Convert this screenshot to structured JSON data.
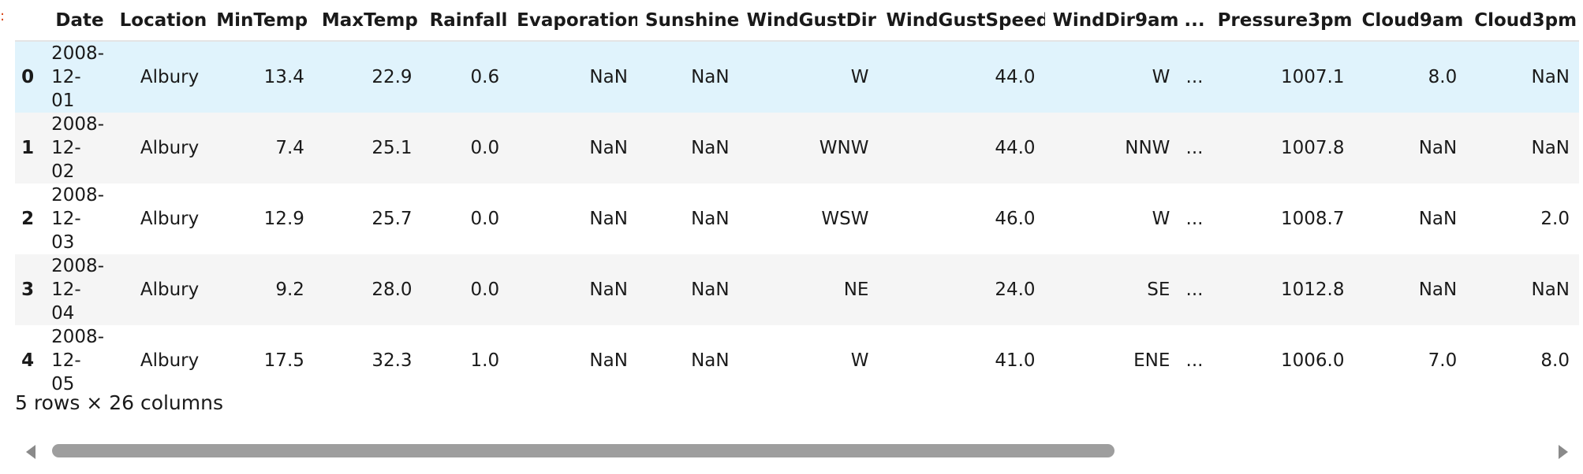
{
  "prompt_marker": ":",
  "table": {
    "columns": [
      "",
      "Date",
      "Location",
      "MinTemp",
      "MaxTemp",
      "Rainfall",
      "Evaporation",
      "Sunshine",
      "WindGustDir",
      "WindGustSpeed",
      "WindDir9am",
      "...",
      "Pressure3pm",
      "Cloud9am",
      "Cloud3pm"
    ],
    "rows": [
      [
        "0",
        "2008-12-01",
        "Albury",
        "13.4",
        "22.9",
        "0.6",
        "NaN",
        "NaN",
        "W",
        "44.0",
        "W",
        "...",
        "1007.1",
        "8.0",
        "NaN"
      ],
      [
        "1",
        "2008-12-02",
        "Albury",
        "7.4",
        "25.1",
        "0.0",
        "NaN",
        "NaN",
        "WNW",
        "44.0",
        "NNW",
        "...",
        "1007.8",
        "NaN",
        "NaN"
      ],
      [
        "2",
        "2008-12-03",
        "Albury",
        "12.9",
        "25.7",
        "0.0",
        "NaN",
        "NaN",
        "WSW",
        "46.0",
        "W",
        "...",
        "1008.7",
        "NaN",
        "2.0"
      ],
      [
        "3",
        "2008-12-04",
        "Albury",
        "9.2",
        "28.0",
        "0.0",
        "NaN",
        "NaN",
        "NE",
        "24.0",
        "SE",
        "...",
        "1012.8",
        "NaN",
        "NaN"
      ],
      [
        "4",
        "2008-12-05",
        "Albury",
        "17.5",
        "32.3",
        "1.0",
        "NaN",
        "NaN",
        "W",
        "41.0",
        "ENE",
        "...",
        "1006.0",
        "7.0",
        "8.0"
      ]
    ],
    "hovered_row": 0
  },
  "shape_text": "5 rows × 26 columns",
  "scrollbar": {
    "left_icon": "scroll-left-arrow-icon",
    "right_icon": "scroll-right-arrow-icon",
    "thumb_fraction": 0.68
  }
}
